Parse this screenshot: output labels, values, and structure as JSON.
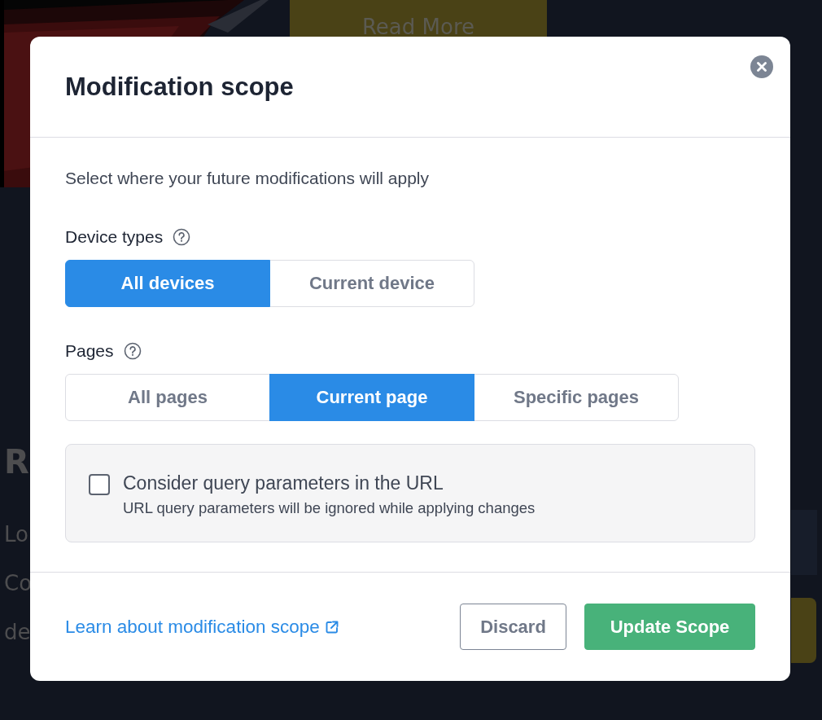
{
  "background": {
    "button": "Read More",
    "heading": "R",
    "lines": [
      "Lo",
      "Co",
      "de"
    ]
  },
  "dialog": {
    "title": "Modification scope",
    "description": "Select where your future modifications will apply",
    "groups": [
      {
        "label": "Device types",
        "options": [
          {
            "label": "All devices",
            "selected": true
          },
          {
            "label": "Current device",
            "selected": false
          }
        ]
      },
      {
        "label": "Pages",
        "options": [
          {
            "label": "All pages",
            "selected": false
          },
          {
            "label": "Current page",
            "selected": true
          },
          {
            "label": "Specific pages",
            "selected": false
          }
        ]
      }
    ],
    "query_option": {
      "label": "Consider query parameters in the URL",
      "hint": "URL query parameters will be ignored while applying changes",
      "checked": false
    },
    "link": "Learn about modification scope",
    "buttons": [
      {
        "label": "Discard",
        "kind": "secondary"
      },
      {
        "label": "Update Scope",
        "kind": "primary"
      }
    ]
  }
}
